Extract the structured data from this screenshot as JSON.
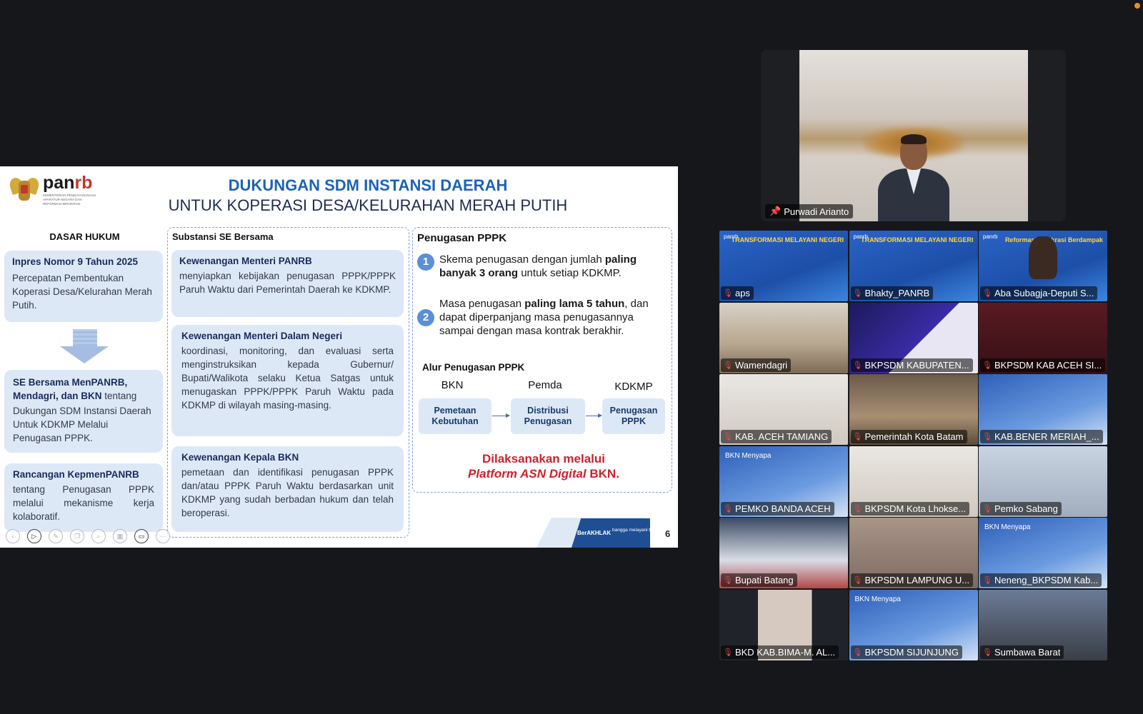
{
  "slide": {
    "logo_brand_pan": "pan",
    "logo_brand_rb": "rb",
    "logo_sub": "KEMENTERIAN PENDAYAGUNAAN APARATUR NEGARA DAN REFORMASI BIROKRASI",
    "title_line1": "DUKUNGAN SDM INSTANSI DAERAH",
    "title_line2": "UNTUK KOPERASI DESA/KELURAHAN MERAH PUTIH",
    "col1": {
      "heading": "DASAR HUKUM",
      "box1_title": "Inpres Nomor 9 Tahun 2025",
      "box1_body": "Percepatan Pembentukan Koperasi Desa/Kelurahan Merah Putih.",
      "box2_title": "SE Bersama MenPANRB, Mendagri, dan BKN",
      "box2_body1": " tentang",
      "box2_body2": "Dukungan SDM Instansi Daerah Untuk KDKMP Melalui Penugasan PPPK.",
      "box3_title": "Rancangan KepmenPANRB",
      "box3_body": "tentang Penugasan PPPK melalui mekanisme kerja kolaboratif."
    },
    "col2": {
      "heading": "Substansi SE Bersama",
      "box1_title": "Kewenangan Menteri PANRB",
      "box1_body": "menyiapkan kebijakan penugasan PPPK/PPPK Paruh Waktu dari Pemerintah Daerah ke KDKMP.",
      "box2_title": "Kewenangan Menteri Dalam Negeri",
      "box2_body": "koordinasi, monitoring, dan evaluasi serta menginstruksikan kepada Gubernur/ Bupati/Walikota selaku Ketua Satgas untuk menugaskan PPPK/PPPK Paruh Waktu pada KDKMP di wilayah masing-masing.",
      "box3_title": "Kewenangan Kepala BKN",
      "box3_body": "pemetaan dan identifikasi penugasan PPPK dan/atau PPPK Paruh Waktu berdasarkan unit KDKMP yang sudah berbadan hukum dan telah beroperasi."
    },
    "col3": {
      "heading": "Penugasan PPPK",
      "point1_num": "1",
      "point1_a": "Skema penugasan dengan jumlah ",
      "point1_b": "paling banyak 3 orang",
      "point1_c": " untuk setiap KDKMP.",
      "point2_num": "2",
      "point2_a": "Masa penugasan ",
      "point2_b": "paling lama 5 tahun",
      "point2_c": ", dan dapat diperpanjang masa penugasannya sampai dengan masa kontrak berakhir.",
      "alur_heading": "Alur Penugasan PPPK",
      "flow_labels": [
        "BKN",
        "Pemda",
        "KDKMP"
      ],
      "flow_steps": [
        "Pemetaan Kebutuhan",
        "Distribusi Penugasan",
        "Penugasan PPPK"
      ],
      "exec_line1": "Dilaksanakan melalui",
      "exec_platform": "Platform ASN Digital",
      "exec_org": " BKN."
    },
    "footer_berakhlak": "BerAKHLAK",
    "footer_bangga": "bangga melayani bangsa",
    "page_number": "6"
  },
  "speaker": {
    "name": "Purwadi Arianto",
    "pin_icon": "pin-icon"
  },
  "participants": [
    {
      "name": "aps",
      "bg": "bg-blue",
      "banner": "TRANSFORMASI MELAYANI NEGERI"
    },
    {
      "name": "Bhakty_PANRB",
      "bg": "bg-blue",
      "banner": "TRANSFORMASI MELAYANI NEGERI"
    },
    {
      "name": "Aba Subagja-Deputi S...",
      "bg": "bg-blue",
      "banner": "Reformasi Birokrasi Berdampak"
    },
    {
      "name": "Wamendagri",
      "bg": "bg-room",
      "banner": ""
    },
    {
      "name": "BKPSDM KABUPATEN...",
      "bg": "bg-purple",
      "banner": ""
    },
    {
      "name": "BKPSDM KAB ACEH SI...",
      "bg": "bg-dark",
      "banner": ""
    },
    {
      "name": "KAB. ACEH TAMIANG",
      "bg": "bg-office",
      "banner": ""
    },
    {
      "name": "Pemerintah Kota Batam",
      "bg": "bg-meeting",
      "banner": ""
    },
    {
      "name": "KAB.BENER MERIAH_...",
      "bg": "bg-bkn",
      "banner": ""
    },
    {
      "name": "PEMKO BANDA ACEH",
      "bg": "bg-bkn",
      "banner": "BKN Menyapa"
    },
    {
      "name": "BKPSDM Kota Lhokse...",
      "bg": "bg-office",
      "banner": ""
    },
    {
      "name": "Pemko Sabang",
      "bg": "bg-glass",
      "banner": ""
    },
    {
      "name": "Bupati Batang",
      "bg": "bg-studio",
      "banner": ""
    },
    {
      "name": "BKPSDM LAMPUNG U...",
      "bg": "bg-blur",
      "banner": ""
    },
    {
      "name": "Neneng_BKPSDM Kab...",
      "bg": "bg-bkn",
      "banner": "BKN Menyapa"
    },
    {
      "name": "BKD KAB.BIMA-M. AL...",
      "bg": "bg-bima",
      "banner": ""
    },
    {
      "name": "BKPSDM SIJUNJUNG",
      "bg": "bg-bkn",
      "banner": "BKN Menyapa"
    },
    {
      "name": "Sumbawa Barat",
      "bg": "bg-man",
      "banner": ""
    }
  ]
}
